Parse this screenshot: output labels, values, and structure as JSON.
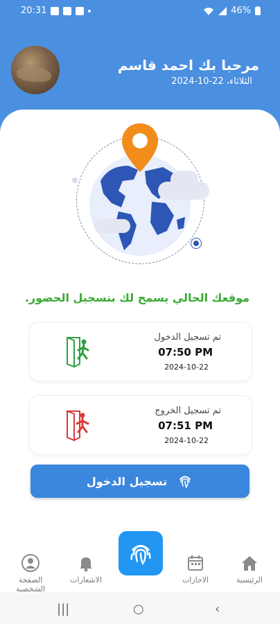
{
  "status_bar": {
    "time": "20:31",
    "battery": "46%"
  },
  "header": {
    "greeting": "مرحبا بك احمد قاسم",
    "date": "الثلاثاء، 22-10-2024"
  },
  "location_message": "موقعك الحالي يسمح لك بتسجيل الحضور.",
  "check_in": {
    "title": "تم تسجيل الدخول",
    "time": "07:50 PM",
    "date": "2024-10-22",
    "icon": "door-enter-icon",
    "color": "#2e9e3e"
  },
  "check_out": {
    "title": "تم تسجيل الخروج",
    "time": "07:51 PM",
    "date": "2024-10-22",
    "icon": "door-exit-icon",
    "color": "#d73a3a"
  },
  "action_button": {
    "label": "تسجيل الدخول",
    "icon": "fingerprint-icon"
  },
  "bottom_nav": {
    "items": [
      {
        "label": "الرئيسية",
        "icon": "home-icon"
      },
      {
        "label": "الاجازات",
        "icon": "calendar-icon"
      },
      {
        "label": "",
        "icon": "fingerprint-icon"
      },
      {
        "label": "الاشعارات",
        "icon": "bell-icon"
      },
      {
        "label": "الصفحة الشخصية",
        "icon": "profile-icon"
      }
    ]
  },
  "colors": {
    "primary": "#4a8fe0",
    "button": "#3b87dd",
    "success": "#3aaa35",
    "fab": "#2196f3"
  }
}
